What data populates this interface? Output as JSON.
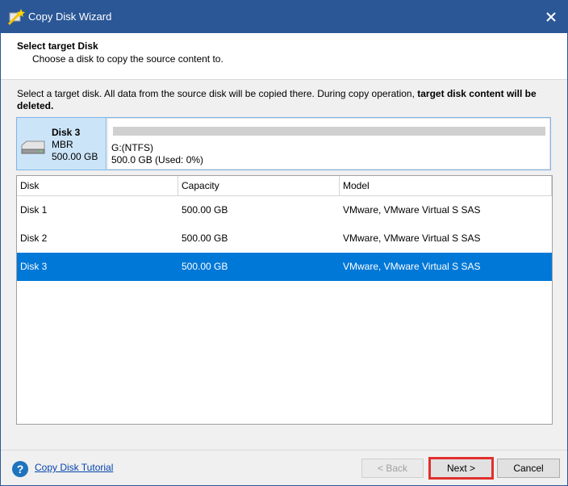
{
  "window": {
    "title": "Copy Disk Wizard",
    "accent_color": "#2b5797"
  },
  "header": {
    "title": "Select target Disk",
    "subtitle": "Choose a disk to copy the source content to."
  },
  "instructions": {
    "normal": "Select a target disk. All data from the source disk will be copied there. During copy operation, ",
    "bold": "target disk content will be deleted."
  },
  "selected_disk": {
    "name": "Disk 3",
    "type": "MBR",
    "size": "500.00 GB",
    "partition_label": "G:(NTFS)",
    "partition_usage": "500.0 GB (Used: 0%)",
    "icon": "hard-drive-icon"
  },
  "table": {
    "columns": [
      "Disk",
      "Capacity",
      "Model"
    ],
    "rows": [
      {
        "disk": "Disk 1",
        "capacity": "500.00 GB",
        "model": "VMware, VMware Virtual S SAS"
      },
      {
        "disk": "Disk 2",
        "capacity": "500.00 GB",
        "model": "VMware, VMware Virtual S SAS"
      },
      {
        "disk": "Disk 3",
        "capacity": "500.00 GB",
        "model": "VMware, VMware Virtual S SAS"
      }
    ],
    "selected_index": 2,
    "selection_color": "#0078d7"
  },
  "footer": {
    "tutorial_link": "Copy Disk Tutorial",
    "back_label": "< Back",
    "next_label": "Next >",
    "cancel_label": "Cancel",
    "highlight_color": "#e0302e"
  }
}
